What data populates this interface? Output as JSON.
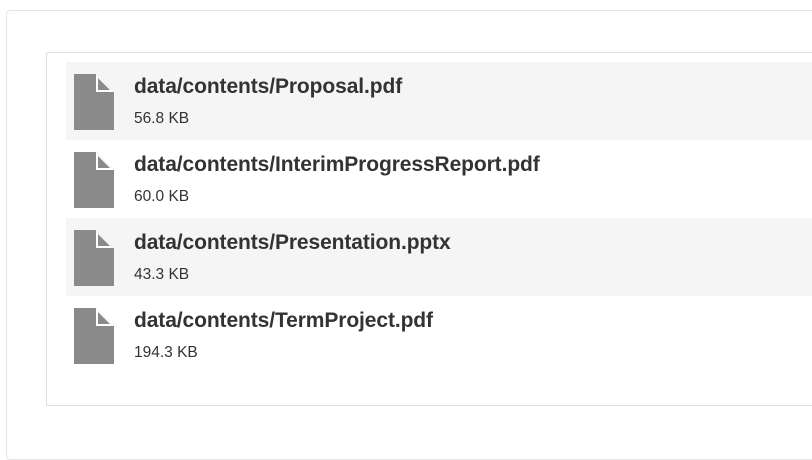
{
  "files": [
    {
      "name": "data/contents/Proposal.pdf",
      "size": "56.8 KB",
      "icon": "file-icon"
    },
    {
      "name": "data/contents/InterimProgressReport.pdf",
      "size": "60.0 KB",
      "icon": "file-icon"
    },
    {
      "name": "data/contents/Presentation.pptx",
      "size": "43.3 KB",
      "icon": "file-icon"
    },
    {
      "name": "data/contents/TermProject.pdf",
      "size": "194.3 KB",
      "icon": "file-icon"
    }
  ],
  "colors": {
    "icon_fill": "#8a8a8a",
    "row_alt_bg": "#f5f5f5",
    "text": "#333333"
  }
}
